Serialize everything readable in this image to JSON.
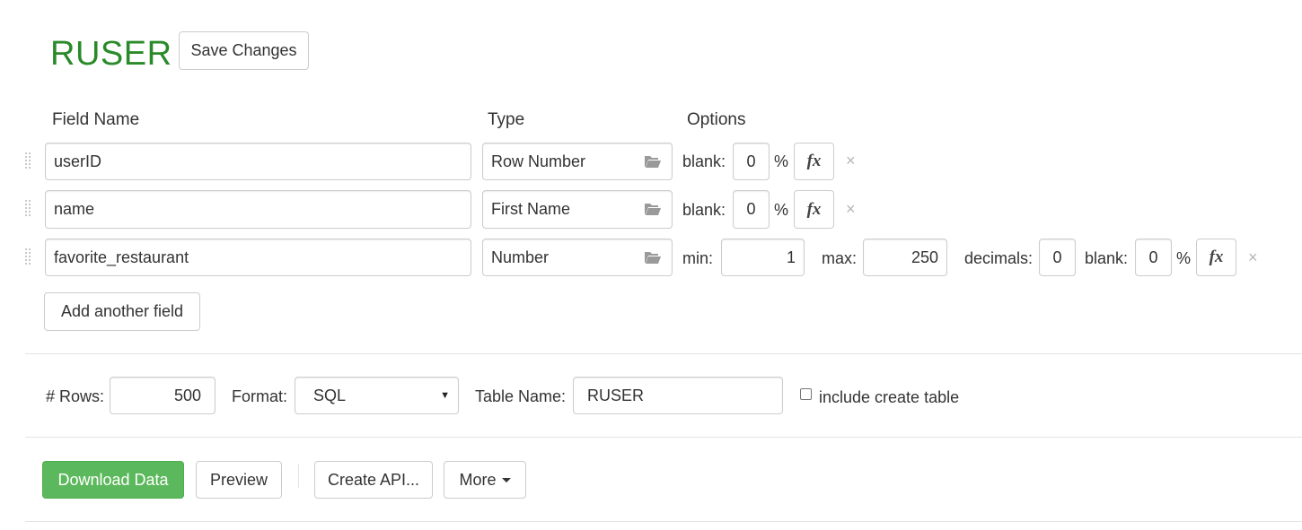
{
  "schema": {
    "title": "RUSER",
    "save_label": "Save Changes"
  },
  "headers": {
    "field_name": "Field Name",
    "type": "Type",
    "options": "Options"
  },
  "fields": [
    {
      "name": "userID",
      "type": "Row Number",
      "blank_label": "blank:",
      "blank_value": "0",
      "percent": "%",
      "fx": "fx",
      "remove": "×"
    },
    {
      "name": "name",
      "type": "First Name",
      "blank_label": "blank:",
      "blank_value": "0",
      "percent": "%",
      "fx": "fx",
      "remove": "×"
    },
    {
      "name": "favorite_restaurant",
      "type": "Number",
      "min_label": "min:",
      "min_value": "1",
      "max_label": "max:",
      "max_value": "250",
      "decimals_label": "decimals:",
      "decimals_value": "0",
      "blank_label": "blank:",
      "blank_value": "0",
      "percent": "%",
      "fx": "fx",
      "remove": "×"
    }
  ],
  "add_field_label": "Add another field",
  "settings": {
    "rows_label": "# Rows:",
    "rows_value": "500",
    "format_label": "Format:",
    "format_value": "SQL",
    "table_name_label": "Table Name:",
    "table_name_value": "RUSER",
    "include_create_table_label": "include create table",
    "include_create_table_checked": false
  },
  "actions": {
    "download": "Download Data",
    "preview": "Preview",
    "create_api": "Create API...",
    "more": "More"
  },
  "colors": {
    "title": "#2a8a2a",
    "download_bg": "#5cb85c",
    "border": "#cccccc"
  },
  "icons": {
    "type_picker": "folder-open-icon",
    "row_drag": "drag-handle-icon",
    "formula": "fx-icon",
    "remove": "close-icon",
    "dropdown": "caret-down-icon"
  }
}
